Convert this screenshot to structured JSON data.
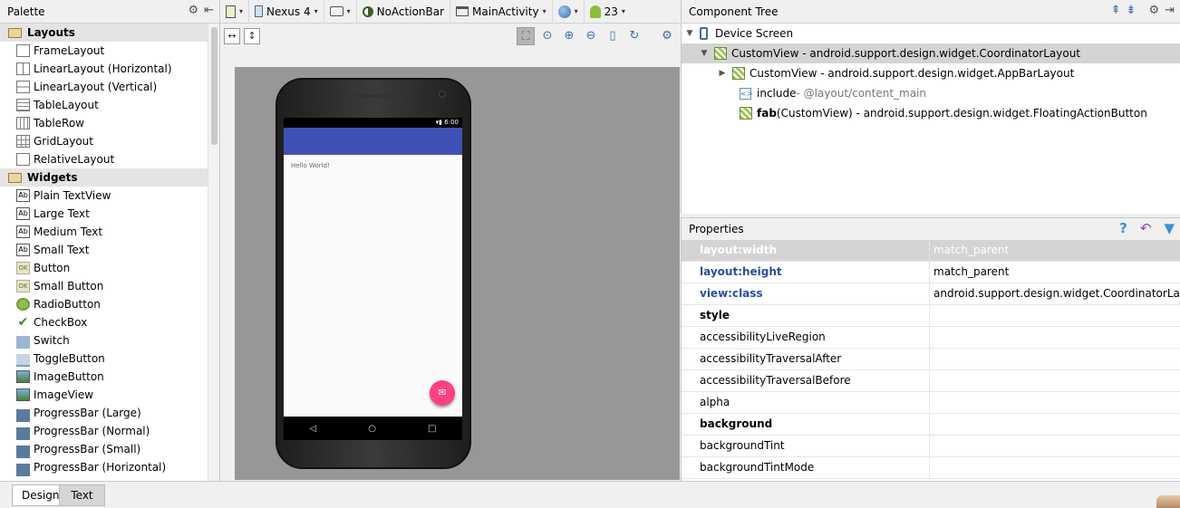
{
  "palette": {
    "title": "Palette",
    "layouts": {
      "label": "Layouts",
      "items": [
        "FrameLayout",
        "LinearLayout (Horizontal)",
        "LinearLayout (Vertical)",
        "TableLayout",
        "TableRow",
        "GridLayout",
        "RelativeLayout"
      ]
    },
    "widgets": {
      "label": "Widgets",
      "items": [
        "Plain TextView",
        "Large Text",
        "Medium Text",
        "Small Text",
        "Button",
        "Small Button",
        "RadioButton",
        "CheckBox",
        "Switch",
        "ToggleButton",
        "ImageButton",
        "ImageView",
        "ProgressBar (Large)",
        "ProgressBar (Normal)",
        "ProgressBar (Small)",
        "ProgressBar (Horizontal)"
      ]
    }
  },
  "toolbar": {
    "device": "Nexus 4",
    "theme": "NoActionBar",
    "activity": "MainActivity",
    "api": "23"
  },
  "preview": {
    "time": "6:00",
    "hello": "Hello World!"
  },
  "tree": {
    "title": "Component Tree",
    "device_screen": "Device Screen",
    "root": "CustomView - android.support.design.widget.CoordinatorLayout",
    "appbar": "CustomView - android.support.design.widget.AppBarLayout",
    "include_label": "include",
    "include_value": " - @layout/content_main",
    "fab_id": "fab",
    "fab_rest": " (CustomView) - android.support.design.widget.FloatingActionButton"
  },
  "properties": {
    "title": "Properties",
    "rows": [
      {
        "key": "layout:width",
        "value": "match_parent"
      },
      {
        "key": "layout:height",
        "value": "match_parent"
      },
      {
        "key": "view:class",
        "value": "android.support.design.widget.CoordinatorLayout"
      },
      {
        "key": "style",
        "value": ""
      },
      {
        "key": "accessibilityLiveRegion",
        "value": ""
      },
      {
        "key": "accessibilityTraversalAfter",
        "value": ""
      },
      {
        "key": "accessibilityTraversalBefore",
        "value": ""
      },
      {
        "key": "alpha",
        "value": ""
      },
      {
        "key": "background",
        "value": ""
      },
      {
        "key": "backgroundTint",
        "value": ""
      },
      {
        "key": "backgroundTintMode",
        "value": ""
      }
    ]
  },
  "tabs": {
    "design": "Design",
    "text": "Text"
  },
  "colors": {
    "appbar": "#3f51b5",
    "fab": "#ff4081",
    "link_blue": "#2b4f9a"
  }
}
